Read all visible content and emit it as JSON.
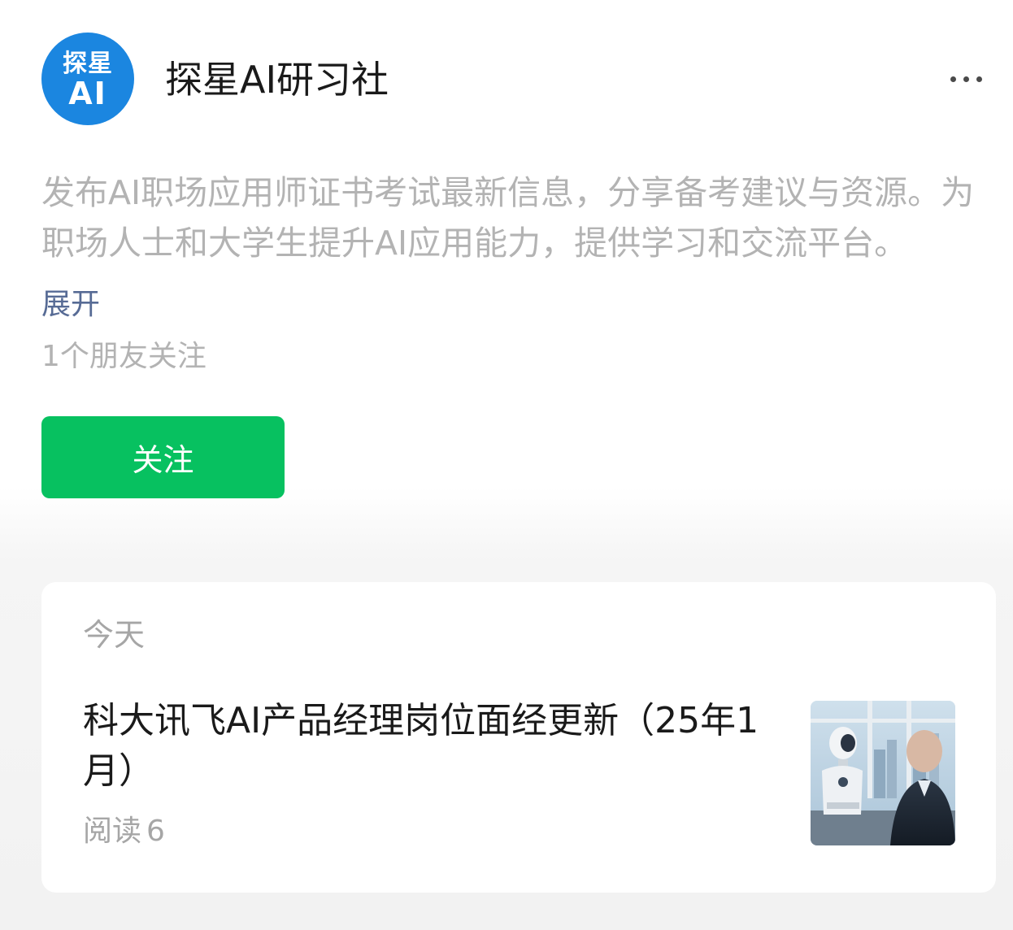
{
  "header": {
    "avatar_line1": "探星",
    "avatar_line2": "AI",
    "account_name": "探星AI研习社"
  },
  "profile": {
    "description": "发布AI职场应用师证书考试最新信息，分享备考建议与资源。为职场人士和大学生提升AI应用能力，提供学习和交流平台。",
    "expand_label": "展开",
    "followers_text": "1个朋友关注",
    "follow_label": "关注"
  },
  "article_list": {
    "date_label": "今天",
    "articles": [
      {
        "title": "科大讯飞AI产品经理岗位面经更新（25年1月）",
        "read_label": "阅读",
        "read_count": "6",
        "thumbnail_icon": "robot-interview-image"
      }
    ]
  },
  "colors": {
    "avatar_blue": "#1b86e0",
    "follow_green": "#07c160",
    "link_blue": "#576b95",
    "muted_gray": "#b3b3b3"
  }
}
